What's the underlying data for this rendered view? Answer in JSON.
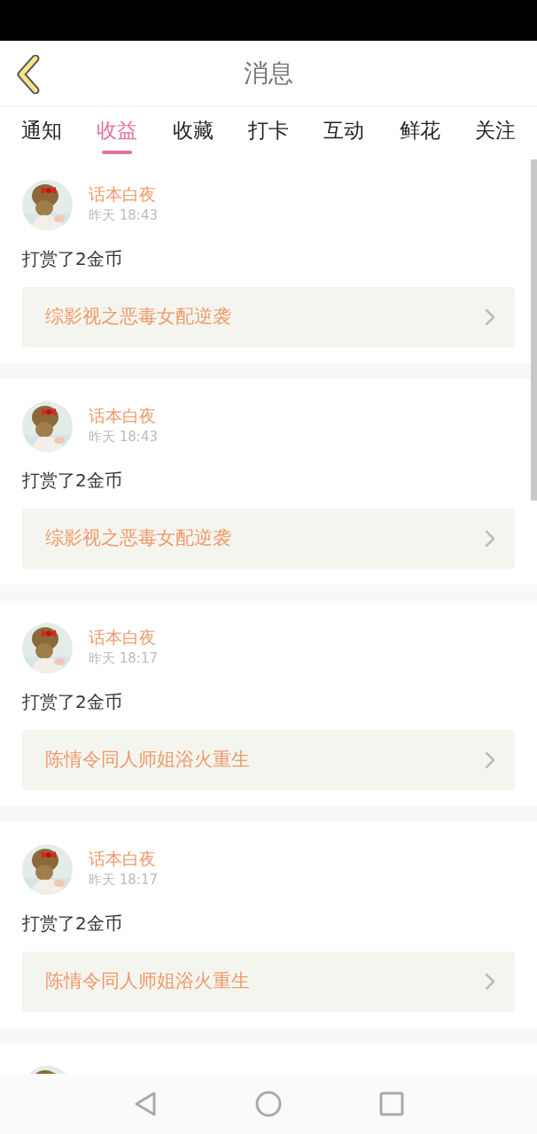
{
  "header": {
    "title": "消息"
  },
  "tabs": [
    {
      "label": "通知",
      "selected": false
    },
    {
      "label": "收益",
      "selected": true
    },
    {
      "label": "收藏",
      "selected": false
    },
    {
      "label": "打卡",
      "selected": false
    },
    {
      "label": "互动",
      "selected": false
    },
    {
      "label": "鲜花",
      "selected": false
    },
    {
      "label": "关注",
      "selected": false
    }
  ],
  "messages": [
    {
      "avatar": {
        "kind": "picture"
      },
      "user": "话本白夜",
      "time": "昨天 18:43",
      "text": "打赏了2金币",
      "book": "综影视之恶毒女配逆袭"
    },
    {
      "avatar": {
        "kind": "picture"
      },
      "user": "话本白夜",
      "time": "昨天 18:43",
      "text": "打赏了2金币",
      "book": "综影视之恶毒女配逆袭"
    },
    {
      "avatar": {
        "kind": "picture"
      },
      "user": "话本白夜",
      "time": "昨天 18:17",
      "text": "打赏了2金币",
      "book": "陈情令同人师姐浴火重生"
    },
    {
      "avatar": {
        "kind": "picture"
      },
      "user": "话本白夜",
      "time": "昨天 18:17",
      "text": "打赏了2金币",
      "book": "陈情令同人师姐浴火重生"
    },
    {
      "avatar": {
        "kind": "picture"
      }
    }
  ]
}
